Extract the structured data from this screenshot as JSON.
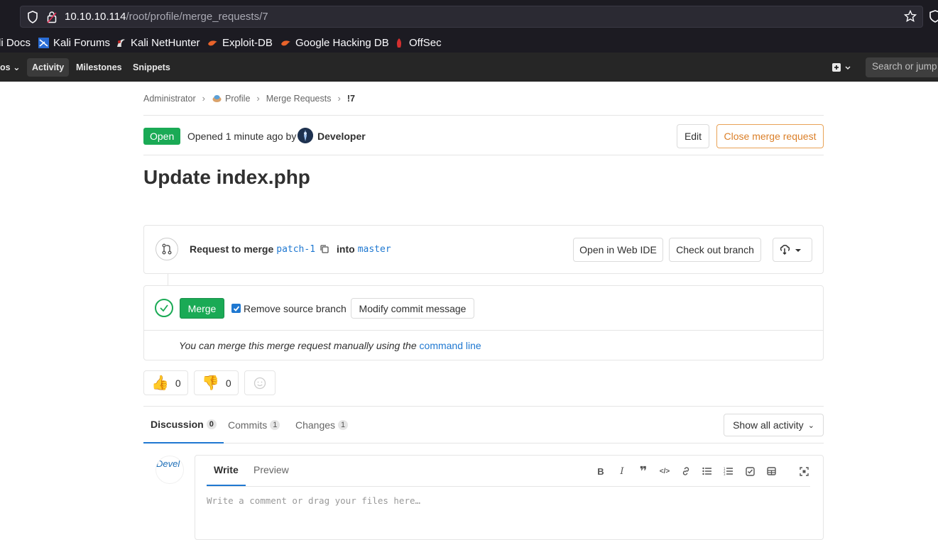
{
  "browser": {
    "url_host": "10.10.10.114",
    "url_path": "/root/profile/merge_requests/7",
    "bookmarks": [
      "li Docs",
      "Kali Forums",
      "Kali NetHunter",
      "Exploit-DB",
      "Google Hacking DB",
      "OffSec"
    ]
  },
  "nav": {
    "partial_item": "os",
    "items": [
      "Activity",
      "Milestones",
      "Snippets"
    ],
    "search_placeholder": "Search or jump to…"
  },
  "breadcrumb": [
    "Administrator",
    "Profile",
    "Merge Requests",
    "!7"
  ],
  "mr": {
    "status": "Open",
    "opened_text": "Opened 1 minute ago by",
    "author": "Developer",
    "edit_label": "Edit",
    "close_label": "Close merge request",
    "title": "Update index.php"
  },
  "widget": {
    "request_prefix": "Request to merge",
    "source_branch": "patch-1",
    "into": "into",
    "target_branch": "master",
    "open_ide": "Open in Web IDE",
    "checkout": "Check out branch",
    "merge_label": "Merge",
    "remove_branch_label": "Remove source branch",
    "modify_commit": "Modify commit message",
    "manual_text": "You can merge this merge request manually using the",
    "command_line": "command line"
  },
  "reactions": {
    "thumbs_up": "0",
    "thumbs_down": "0"
  },
  "tabs": [
    {
      "label": "Discussion",
      "count": "0"
    },
    {
      "label": "Commits",
      "count": "1"
    },
    {
      "label": "Changes",
      "count": "1"
    }
  ],
  "activity_filter": "Show all activity",
  "comment": {
    "avatar_text": "Devel",
    "write_tab": "Write",
    "preview_tab": "Preview",
    "placeholder": "Write a comment or drag your files here…"
  },
  "colors": {
    "accent": "#1f78d1",
    "success": "#1aaa55",
    "warning": "#db7f28",
    "nav_bg": "#262626"
  }
}
